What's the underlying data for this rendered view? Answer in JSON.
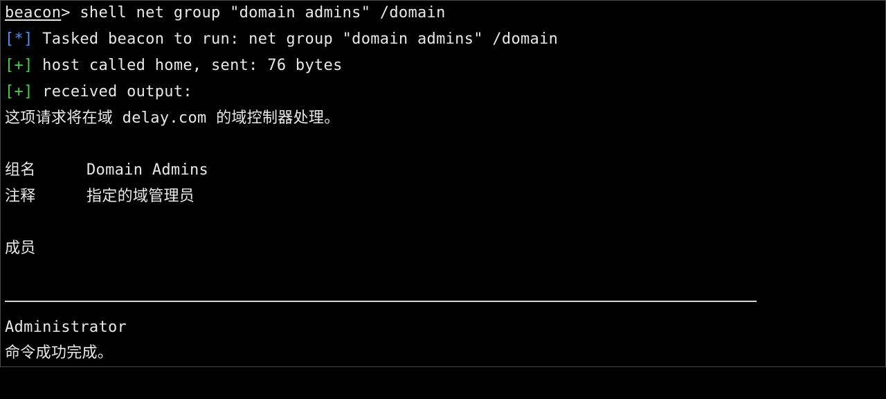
{
  "console": {
    "prompt": "beacon",
    "command": "> shell net group \"domain admins\" /domain",
    "lines": [
      {
        "marker": "[*]",
        "text": " Tasked beacon to run: net group \"domain admins\" /domain"
      },
      {
        "marker": "[+]",
        "text": " host called home, sent: 76 bytes"
      },
      {
        "marker": "[+]",
        "text": " received output:"
      }
    ],
    "output": {
      "intro": "这项请求将在域 delay.com 的域控制器处理。",
      "group_label": "组名",
      "group_value": "Domain Admins",
      "comment_label": "注释",
      "comment_value": "指定的域管理员",
      "members_label": "成员",
      "member": "Administrator",
      "done": "命令成功完成。"
    }
  },
  "colors": {
    "background": "#000000",
    "text": "#e8e8e8",
    "info_marker": "#4a90ff",
    "success_marker": "#3fd13f"
  }
}
